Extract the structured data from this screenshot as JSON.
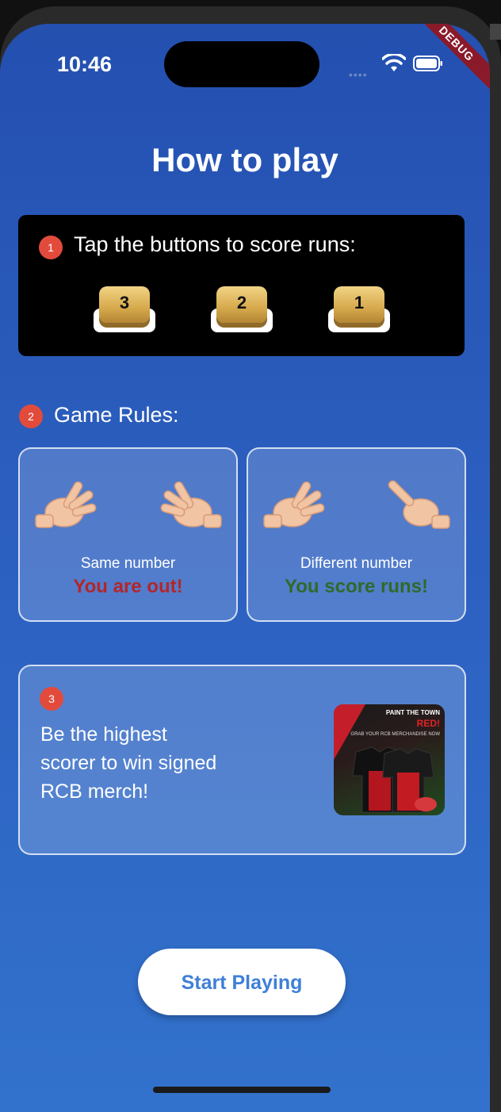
{
  "status_bar": {
    "time": "10:46",
    "debug_label": "DEBUG"
  },
  "title": "How to play",
  "step1": {
    "number": "1",
    "instruction": "Tap the buttons to score runs:",
    "buttons": [
      "3",
      "2",
      "1"
    ]
  },
  "step2": {
    "number": "2",
    "heading": "Game Rules:",
    "rules": [
      {
        "caption": "Same number",
        "verdict": "You are out!",
        "verdict_color": "#b3262b"
      },
      {
        "caption": "Different number",
        "verdict": "You score runs!",
        "verdict_color": "#2f6a2a"
      }
    ]
  },
  "step3": {
    "number": "3",
    "text": "Be the highest scorer to win signed RCB merch!",
    "merch_image": {
      "headline": "PAINT THE TOWN",
      "highlight": "RED!",
      "sub": "GRAB YOUR RCB MERCHANDISE NOW"
    }
  },
  "start_button": "Start Playing"
}
